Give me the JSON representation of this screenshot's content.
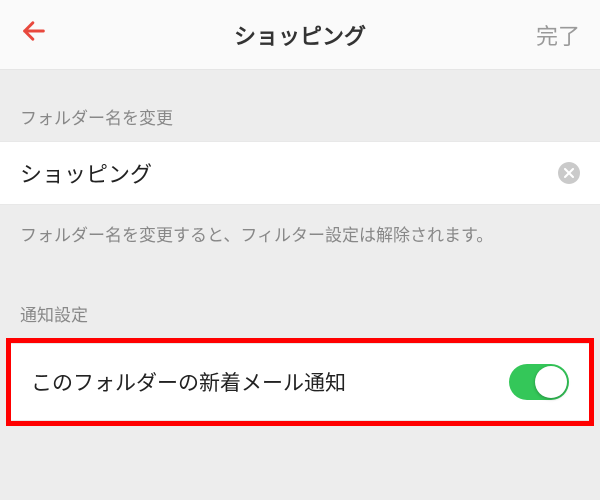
{
  "header": {
    "title": "ショッピング",
    "done_label": "完了"
  },
  "folder_section": {
    "label": "フォルダー名を変更",
    "value": "ショッピング",
    "helper": "フォルダー名を変更すると、フィルター設定は解除されます。"
  },
  "notification_section": {
    "label": "通知設定",
    "toggle_label": "このフォルダーの新着メール通知",
    "toggle_on": true
  }
}
